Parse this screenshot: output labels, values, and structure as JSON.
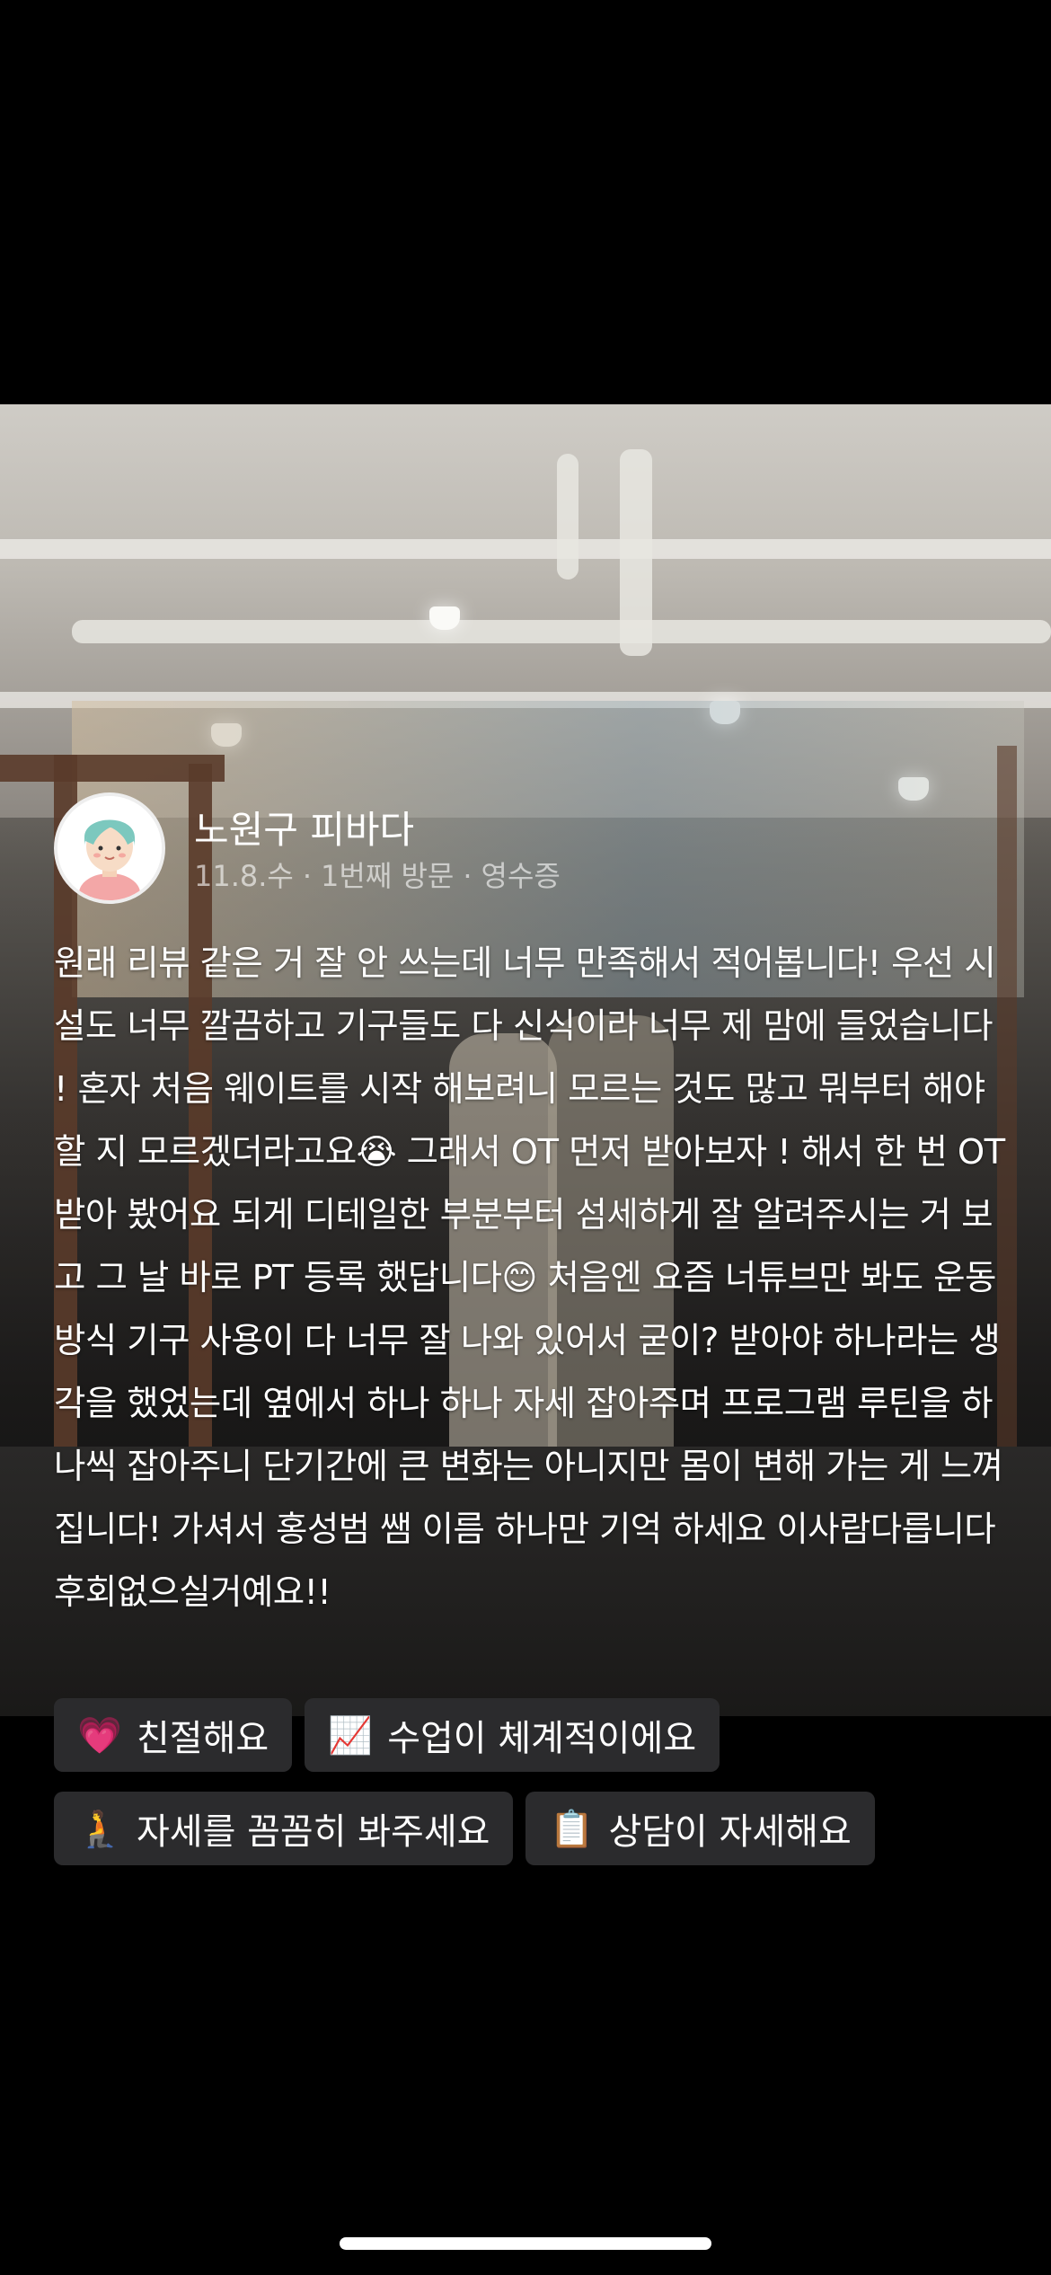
{
  "review": {
    "author_name": "노원구 피바다",
    "meta": {
      "date": "11.8.수",
      "visit": "1번째 방문",
      "proof": "영수증",
      "separator": "·"
    },
    "body": "원래 리뷰 같은 거 잘 안 쓰는데 너무 만족해서 적어봅니다! 우선 시설도 너무 깔끔하고 기구들도 다 신식이라 너무 제 맘에 들었습니다 ! 혼자 처음 웨이트를 시작 해보려니 모르는 것도 많고 뭐부터 해야할 지 모르겠더라고요😭 그래서 OT 먼저 받아보자 ! 해서 한 번 OT 받아 봤어요 되게 디테일한 부분부터 섬세하게 잘 알려주시는 거 보고 그 날 바로 PT 등록 했답니다😊 처음엔 요즘 너튜브만 봐도 운동 방식 기구 사용이 다 너무 잘 나와 있어서 굳이? 받아야 하나라는 생각을 했었는데 옆에서 하나 하나 자세 잡아주며 프로그램 루틴을 하나씩 잡아주니 단기간에 큰 변화는 아니지만 몸이 변해 가는 게 느껴집니다! 가셔서 홍성범 쌤 이름 하나만 기억 하세요 이사람다릅니다 후회없으실거예요!!"
  },
  "tags": [
    {
      "emoji": "💗",
      "label": "친절해요"
    },
    {
      "emoji": "📈",
      "label": "수업이 체계적이에요"
    },
    {
      "emoji": "🧎",
      "label": "자세를 꼼꼼히 봐주세요"
    },
    {
      "emoji": "📋",
      "label": "상담이 자세해요"
    }
  ],
  "colors": {
    "background": "#000000",
    "tag_background": "#2b2b2d",
    "text": "#ffffff",
    "meta_text": "rgba(255,255,255,0.6)"
  },
  "icons": {
    "avatar": "user-avatar-icon"
  }
}
